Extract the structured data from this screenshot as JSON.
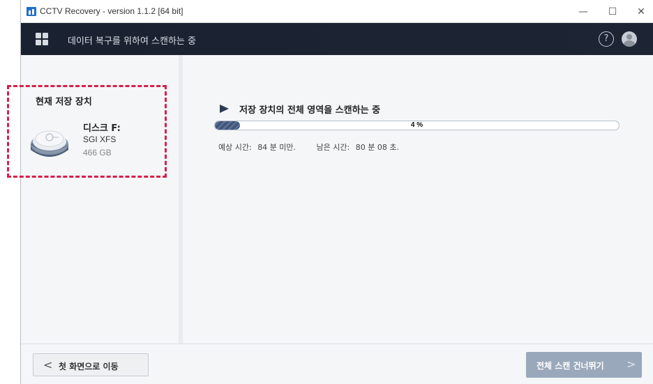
{
  "window": {
    "title": "CCTV Recovery - version 1.1.2 [64 bit]",
    "minimize_glyph": "—",
    "maximize_glyph": "☐",
    "close_glyph": "✕"
  },
  "appbar": {
    "title": "데이터 복구를 위하여 스캔하는 중",
    "help_glyph": "?"
  },
  "sidebar": {
    "heading": "현재 저장 장치",
    "disk": {
      "name": "디스크 F:",
      "filesystem": "SGI XFS",
      "size": "466 GB"
    }
  },
  "scan": {
    "title": "저장 장치의 전체 영역을 스캔하는 중",
    "progress_percent": 4,
    "progress_label": "4 %",
    "estimated_label": "예상 시간:",
    "estimated_value": "84 분 미만.",
    "remaining_label": "남은 시간:",
    "remaining_value": "80 분 08 초."
  },
  "footer": {
    "back_label": "첫 화면으로 이동",
    "skip_label": "전체 스캔 건너뛰기",
    "back_chevron": "<",
    "skip_chevron": ">"
  },
  "colors": {
    "appbar": "#1a2232",
    "progress_fill": "#4a5f84",
    "skip_button": "#9aa8bb",
    "highlight": "#d6204a"
  }
}
